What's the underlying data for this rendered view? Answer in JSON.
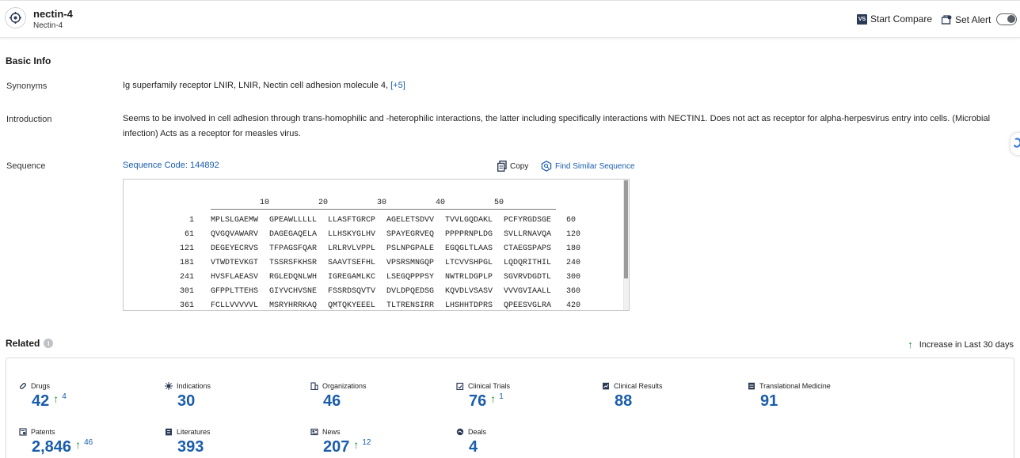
{
  "header": {
    "title": "nectin-4",
    "subtitle": "Nectin-4",
    "start_compare": "Start Compare",
    "compare_badge": "VS",
    "set_alert": "Set Alert"
  },
  "basic_info": {
    "section_title": "Basic Info",
    "synonyms_label": "Synonyms",
    "synonyms_value": "Ig superfamily receptor LNIR,  LNIR,  Nectin cell adhesion molecule 4,",
    "synonyms_more": "[+5]",
    "introduction_label": "Introduction",
    "introduction_value": "Seems to be involved in cell adhesion through trans-homophilic and -heterophilic interactions, the latter including specifically interactions with NECTIN1. Does not act as receptor for alpha-herpesvirus entry into cells. (Microbial infection) Acts as a receptor for measles virus.",
    "sequence_label": "Sequence",
    "sequence_code": "Sequence Code: 144892",
    "copy": "Copy",
    "find_similar": "Find Similar Sequence"
  },
  "sequence": {
    "ruler": [
      "10",
      "20",
      "30",
      "40",
      "50"
    ],
    "rows": [
      {
        "start": "1",
        "segs": [
          "MPLSLGAEMW",
          "GPEAWLLLLL",
          "LLASFTGRCP",
          "AGELETSDVV",
          "TVVLGQDAKL",
          "PCFYRGDSGE"
        ],
        "end": "60"
      },
      {
        "start": "61",
        "segs": [
          "QVGQVAWARV",
          "DAGEGAQELA",
          "LLHSKYGLHV",
          "SPAYEGRVEQ",
          "PPPPRNPLDG",
          "SVLLRNAVQA"
        ],
        "end": "120"
      },
      {
        "start": "121",
        "segs": [
          "DEGEYECRVS",
          "TFPAGSFQAR",
          "LRLRVLVPPL",
          "PSLNPGPALE",
          "EGQGLTLAAS",
          "CTAEGSPAPS"
        ],
        "end": "180"
      },
      {
        "start": "181",
        "segs": [
          "VTWDTEVKGT",
          "TSSRSFKHSR",
          "SAAVTSEFHL",
          "VPSRSMNGQP",
          "LTCVVSHPGL",
          "LQDQRITHIL"
        ],
        "end": "240"
      },
      {
        "start": "241",
        "segs": [
          "HVSFLAEASV",
          "RGLEDQNLWH",
          "IGREGAMLKC",
          "LSEGQPPPSY",
          "NWTRLDGPLP",
          "SGVRVDGDTL"
        ],
        "end": "300"
      },
      {
        "start": "301",
        "segs": [
          "GFPPLTTEHS",
          "GIYVCHVSNE",
          "FSSRDSQVTV",
          "DVLDPQEDSG",
          "KQVDLVSASV",
          "VVVGVIAALL"
        ],
        "end": "360"
      },
      {
        "start": "361",
        "segs": [
          "FCLLVVVVVL",
          "MSRYHRRKAQ",
          "QMTQKYEEEL",
          "TLTRENSIRR",
          "LHSHHTDPRS",
          "QPEESVGLRA"
        ],
        "end": "420"
      }
    ]
  },
  "related": {
    "title": "Related",
    "increase_label": "Increase in Last 30 days",
    "stats": [
      {
        "label": "Drugs",
        "icon": "pill-icon",
        "value": "42",
        "increase": "4"
      },
      {
        "label": "Indications",
        "icon": "virus-icon",
        "value": "30",
        "increase": ""
      },
      {
        "label": "Organizations",
        "icon": "building-icon",
        "value": "46",
        "increase": ""
      },
      {
        "label": "Clinical Trials",
        "icon": "clipboard-icon",
        "value": "76",
        "increase": "1"
      },
      {
        "label": "Clinical Results",
        "icon": "chart-doc-icon",
        "value": "88",
        "increase": ""
      },
      {
        "label": "Translational Medicine",
        "icon": "doc-icon",
        "value": "91",
        "increase": ""
      },
      {
        "label": "Patents",
        "icon": "patent-icon",
        "value": "2,846",
        "increase": "46"
      },
      {
        "label": "Literatures",
        "icon": "book-icon",
        "value": "393",
        "increase": ""
      },
      {
        "label": "News",
        "icon": "news-icon",
        "value": "207",
        "increase": "12"
      },
      {
        "label": "Deals",
        "icon": "handshake-icon",
        "value": "4",
        "increase": ""
      }
    ]
  },
  "colors": {
    "accent": "#1a5dab",
    "increase": "#1f8a2e"
  }
}
